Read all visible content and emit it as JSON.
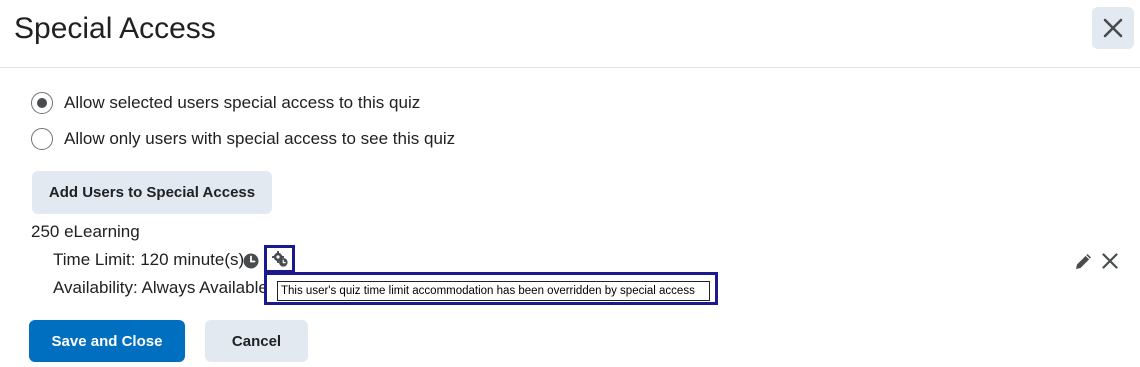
{
  "dialog": {
    "title": "Special Access",
    "close_icon": "close-icon"
  },
  "options": [
    {
      "label": "Allow selected users special access to this quiz",
      "selected": true
    },
    {
      "label": "Allow only users with special access to see this quiz",
      "selected": false
    }
  ],
  "add_users_button": "Add Users to Special Access",
  "user_entry": {
    "name": "250 eLearning",
    "time_limit": "Time Limit: 120 minute(s)",
    "availability": "Availability: Always Available",
    "clock_icon": "clock-icon",
    "override_icon": "gear-override-icon",
    "tooltip": "This user's quiz time limit accommodation has been overridden by special access",
    "edit_icon": "pencil-icon",
    "remove_icon": "close-icon"
  },
  "footer": {
    "save_label": "Save and Close",
    "cancel_label": "Cancel"
  },
  "colors": {
    "primary": "#006fbf",
    "secondary_bg": "#e3e9f1",
    "highlight_border": "#1a1a8c"
  }
}
